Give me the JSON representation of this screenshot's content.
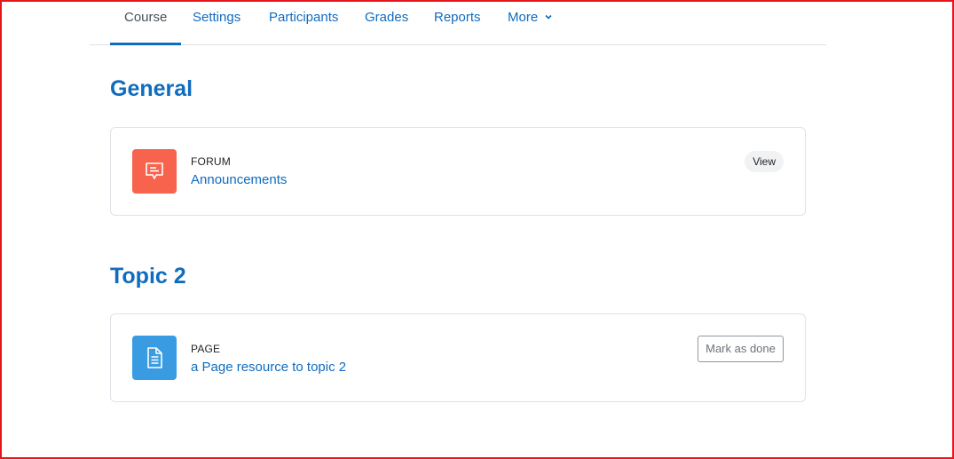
{
  "nav": {
    "tabs": [
      {
        "label": "Course"
      },
      {
        "label": "Settings"
      },
      {
        "label": "Participants"
      },
      {
        "label": "Grades"
      },
      {
        "label": "Reports"
      },
      {
        "label": "More"
      }
    ],
    "active_tab": "Course"
  },
  "sections": [
    {
      "title": "General",
      "activity": {
        "type": "FORUM",
        "name": "Announcements",
        "icon": "forum-icon",
        "icon_color": "#f7634d",
        "action": "View"
      }
    },
    {
      "title": "Topic 2",
      "activity": {
        "type": "PAGE",
        "name": "a Page resource to topic 2",
        "icon": "page-icon",
        "icon_color": "#399be2",
        "action": "Mark as done"
      }
    }
  ],
  "colors": {
    "link": "#0f6cbf",
    "frame": "#e8141b"
  }
}
